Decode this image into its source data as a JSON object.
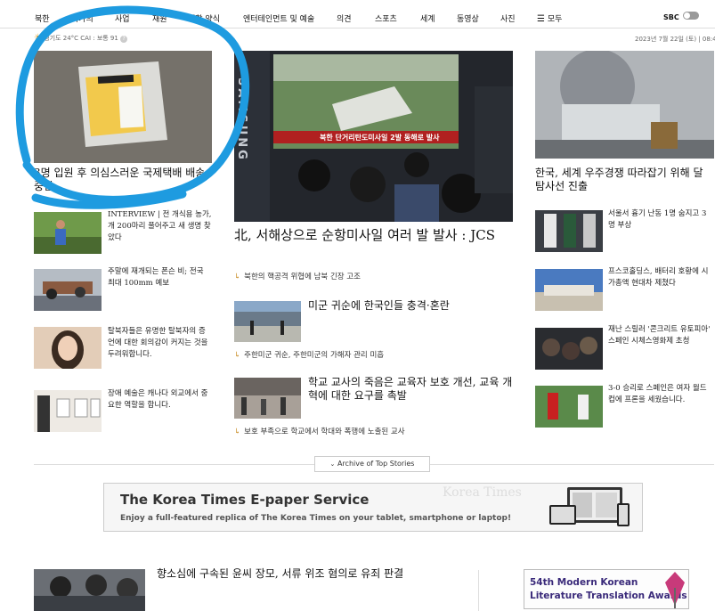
{
  "nav": {
    "items": [
      "북한",
      "국가의",
      "사업",
      "재원",
      "생활 양식",
      "엔터테인먼트 및 예술",
      "의견",
      "스포츠",
      "세계",
      "동영상",
      "사진"
    ],
    "all_label": "모두",
    "sbc_label": "SBC"
  },
  "weather": {
    "text": "경기도 24°C CAI : 보통 91"
  },
  "date": {
    "text": "2023년 7월 22일 (토) | 08:43"
  },
  "left": {
    "main_headline": "3명 입원 후 의심스러운 국제택배 배송중단",
    "list": [
      {
        "kicker": "INTERVIEW",
        "text": " | 전 개식용 농가, 개 200마리 풀어주고 새 생명 찾았다"
      },
      {
        "text": "주말에 재개되는 폰슨 비; 전국 최대 100mm 예보"
      },
      {
        "text": "탈북자들은 유명한 탈북자의 증언에 대한 회의감이 커지는 것을 두려워합니다."
      },
      {
        "text": "장애 예술은 캐나다 외교에서 중요한 역할을 합니다."
      }
    ]
  },
  "center": {
    "tv_caption": "북한 단거리탄도미사일 2발 동해로 발사",
    "main_headline": "北, 서해상으로 순항미사일 여러 발 발사 : JCS",
    "main_sub": "북한의 핵공격 위협에 남북 긴장 고조",
    "story2": {
      "headline": "미군 귀순에 한국인들 충격·혼란",
      "sub": "주한미군 귀순, 주한미군의 가해자 관리 미흡"
    },
    "story3": {
      "headline": "학교 교사의 죽음은 교육자 보호 개선, 교육 개혁에 대한 요구를 촉발",
      "sub": "보호 부족으로 학교에서 학대와 폭행에 노출된 교사"
    }
  },
  "right": {
    "main_headline": "한국, 세계 우주경쟁 따라잡기 위해 달 탐사선 진출",
    "list": [
      {
        "text": "서울서 흉기 난동 1명 숨지고 3명 부상"
      },
      {
        "text": "프스코홀딩스, 배터리 호황에 시가총액 현대차 제쳤다"
      },
      {
        "text": "재난 스릴러 '콘크리트 유토피아' 스페인 시체스영화제 초청"
      },
      {
        "text": "3-0 승리로 스페인은 여자 월드컵에 프론을 세웠습니다."
      }
    ]
  },
  "archive": {
    "label": "Archive of Top Stories"
  },
  "banner": {
    "title": "The Korea Times E-paper Service",
    "subtitle": "Enjoy a full-featured replica of The Korea Times on your tablet, smartphone or laptop!",
    "bg_text": "Korea Times"
  },
  "bottom": {
    "headline": "향소심에 구속된 윤씨 장모, 서류 위조 혐의로 유죄 판결",
    "ad_line1": "54th Modern Korean",
    "ad_line2": "Literature Translation Awards"
  },
  "samsung": "SAMSUNG",
  "colors": {
    "accent": "#c88a20",
    "annotation": "#1e9be0",
    "ad_text": "#3a2a7a"
  }
}
